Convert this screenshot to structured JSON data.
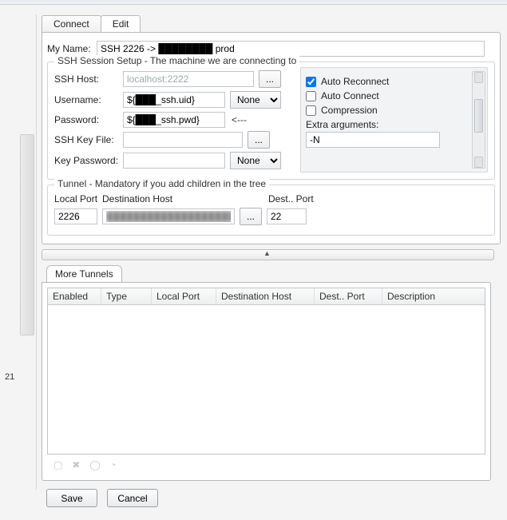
{
  "left_panel": {
    "line_number": "21"
  },
  "tabs": {
    "connect": "Connect",
    "edit": "Edit"
  },
  "myname": {
    "label": "My Name:",
    "value": "SSH 2226 -> ████████ prod"
  },
  "session": {
    "legend": "SSH Session Setup - The machine we are connecting to",
    "host_label": "SSH Host:",
    "host_placeholder": "localhost:2222",
    "host_value": "",
    "user_label": "Username:",
    "user_value": "${███_ssh.uid}",
    "user_select": "None",
    "pass_label": "Password:",
    "pass_value": "${███_ssh.pwd}",
    "pass_note": "<---",
    "keyfile_label": "SSH Key File:",
    "keyfile_value": "",
    "keypass_label": "Key Password:",
    "keypass_value": "",
    "keypass_select": "None",
    "browse_label": "...",
    "options": {
      "auto_reconnect": "Auto Reconnect",
      "auto_reconnect_checked": true,
      "auto_connect": "Auto Connect",
      "auto_connect_checked": false,
      "compression": "Compression",
      "compression_checked": false,
      "extra_label": "Extra arguments:",
      "extra_value": "-N"
    }
  },
  "tunnel": {
    "legend": "Tunnel - Mandatory if you add children in the tree",
    "localport_label": "Local Port",
    "localport_value": "2226",
    "desthost_label": "Destination Host",
    "desthost_value": "███████████████████",
    "destport_label": "Dest.. Port",
    "destport_value": "22",
    "browse_label": "..."
  },
  "more_tunnels": {
    "tab": "More Tunnels",
    "cols": {
      "enabled": "Enabled",
      "type": "Type",
      "localport": "Local Port",
      "desthost": "Destination Host",
      "destport": "Dest.. Port",
      "description": "Description"
    }
  },
  "actions": {
    "save": "Save",
    "cancel": "Cancel"
  }
}
